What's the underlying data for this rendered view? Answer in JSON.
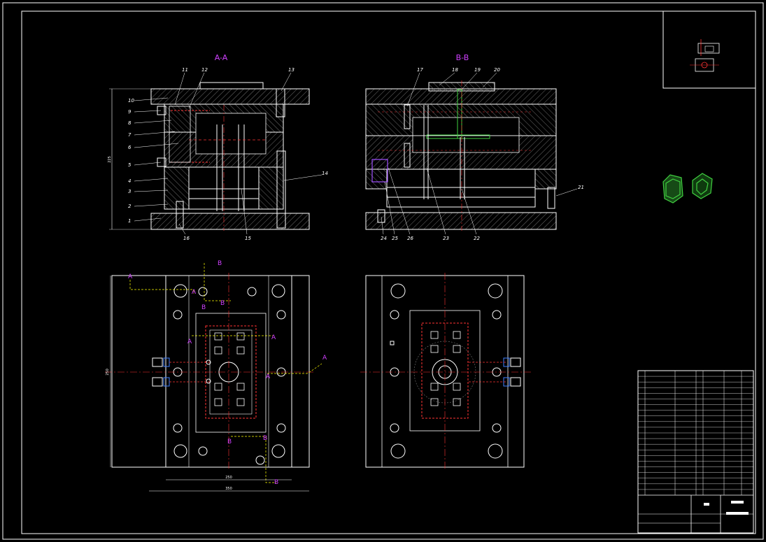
{
  "drawing": {
    "view_labels": {
      "section_aa": "A-A",
      "section_bb": "B-B"
    },
    "cut_markers": {
      "a": "A",
      "b": "B"
    },
    "part_numbers_aa_left": [
      "10",
      "9",
      "8",
      "7",
      "6",
      "5",
      "4",
      "3",
      "2",
      "1"
    ],
    "part_numbers_aa_top": [
      "11",
      "12",
      "13"
    ],
    "part_numbers_aa_right": [
      "14"
    ],
    "part_numbers_aa_bottom": [
      "16",
      "15"
    ],
    "part_numbers_bb_top": [
      "17",
      "18",
      "19",
      "20"
    ],
    "part_numbers_bb_right": [
      "21"
    ],
    "part_numbers_bb_bottom": [
      "24",
      "25",
      "26",
      "23",
      "22"
    ],
    "dimensions": {
      "plan_width_outer": "350",
      "plan_width_inner": "250",
      "aa_height": "225",
      "plan_height": "250"
    }
  },
  "colors": {
    "background": "#000000",
    "line": "#ffffff",
    "hatch": "#9a9a9a",
    "centerline": "#ff2020",
    "view_label": "#d040ff",
    "cut_marker": "#d040ff",
    "guide_yellow": "#ffff00",
    "part_green": "#40d040",
    "cooling_blue": "#4080ff"
  },
  "title_block": {
    "rows": 22
  }
}
